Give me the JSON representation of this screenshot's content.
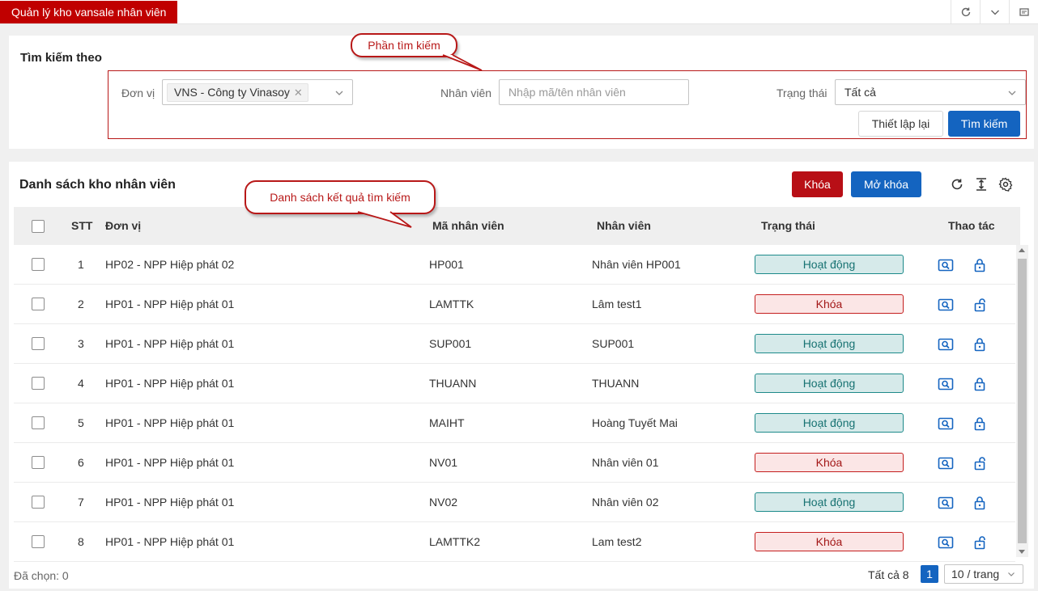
{
  "app": {
    "tab_title": "Quản lý kho vansale nhân viên"
  },
  "topbar_icons": [
    "refresh-icon",
    "chevron-down-icon",
    "fullscreen-icon"
  ],
  "search": {
    "title": "Tìm kiếm theo",
    "unit_label": "Đơn vị",
    "unit_tag": "VNS - Công ty Vinasoy",
    "employee_label": "Nhân viên",
    "employee_placeholder": "Nhập mã/tên nhân viên",
    "status_label": "Trạng thái",
    "status_value": "Tất cả",
    "reset_label": "Thiết lập lại",
    "search_label": "Tìm kiếm"
  },
  "callouts": {
    "search": "Phần tìm kiếm",
    "list": "Danh sách kết quả tìm kiếm"
  },
  "list": {
    "title": "Danh sách kho nhân viên",
    "lock_label": "Khóa",
    "unlock_label": "Mở khóa",
    "columns": {
      "stt": "STT",
      "unit": "Đơn vị",
      "code": "Mã nhân viên",
      "employee": "Nhân viên",
      "status": "Trạng thái",
      "actions": "Thao tác"
    },
    "rows": [
      {
        "stt": "1",
        "unit": "HP02 - NPP Hiệp phát 02",
        "code": "HP001",
        "employee": "Nhân viên HP001",
        "status": "Hoạt động",
        "active": true
      },
      {
        "stt": "2",
        "unit": "HP01 - NPP Hiệp phát 01",
        "code": "LAMTTK",
        "employee": "Lâm test1",
        "status": "Khóa",
        "active": false
      },
      {
        "stt": "3",
        "unit": "HP01 - NPP Hiệp phát 01",
        "code": "SUP001",
        "employee": "SUP001",
        "status": "Hoạt động",
        "active": true
      },
      {
        "stt": "4",
        "unit": "HP01 - NPP Hiệp phát 01",
        "code": "THUANN",
        "employee": "THUANN",
        "status": "Hoạt động",
        "active": true
      },
      {
        "stt": "5",
        "unit": "HP01 - NPP Hiệp phát 01",
        "code": "MAIHT",
        "employee": "Hoàng Tuyết Mai",
        "status": "Hoạt động",
        "active": true
      },
      {
        "stt": "6",
        "unit": "HP01 - NPP Hiệp phát 01",
        "code": "NV01",
        "employee": "Nhân viên 01",
        "status": "Khóa",
        "active": false
      },
      {
        "stt": "7",
        "unit": "HP01 - NPP Hiệp phát 01",
        "code": "NV02",
        "employee": "Nhân viên 02",
        "status": "Hoạt động",
        "active": true
      },
      {
        "stt": "8",
        "unit": "HP01 - NPP Hiệp phát 01",
        "code": "LAMTTK2",
        "employee": "Lam test2",
        "status": "Khóa",
        "active": false
      }
    ],
    "selected": "Đã chọn: 0",
    "total": "Tất cả 8",
    "page": "1",
    "page_size": "10 / trang"
  },
  "colors": {
    "brand_red": "#c00000",
    "primary_blue": "#1464c0",
    "active_green": "#1d8a8a",
    "locked_red": "#c41e1e"
  }
}
